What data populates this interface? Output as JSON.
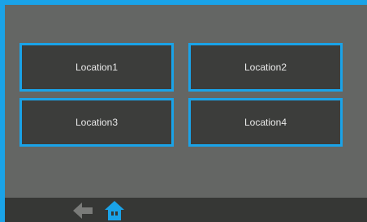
{
  "locations": [
    {
      "label": "Location1"
    },
    {
      "label": "Location2"
    },
    {
      "label": "Location3"
    },
    {
      "label": "Location4"
    }
  ],
  "nav": {
    "back_icon": "back-arrow-icon",
    "home_icon": "home-icon"
  },
  "colors": {
    "accent": "#1aa3e8",
    "panel_bg": "#646664",
    "button_bg": "#3c3d3b",
    "bottom_bar": "#363735",
    "text": "#e9e9e9",
    "inactive_icon": "#7a7b79"
  }
}
